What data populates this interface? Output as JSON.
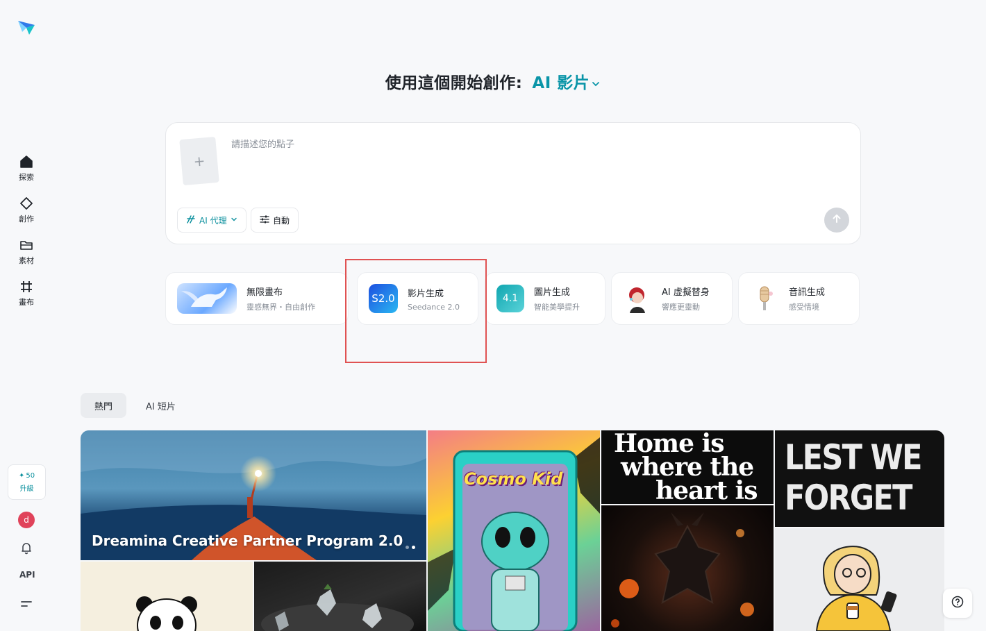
{
  "sidebar": {
    "items": [
      {
        "id": "explore",
        "label": "探索",
        "icon": "home-icon"
      },
      {
        "id": "create",
        "label": "創作",
        "icon": "diamond-icon"
      },
      {
        "id": "assets",
        "label": "素材",
        "icon": "folder-icon"
      },
      {
        "id": "canvas",
        "label": "畫布",
        "icon": "canvas-icon"
      }
    ],
    "credits": "50",
    "upgrade_label": "升級",
    "avatar_initial": "d",
    "api_label": "API"
  },
  "heading": {
    "prefix": "使用這個開始創作:",
    "mode": "AI 影片"
  },
  "prompt": {
    "placeholder": "請描述您的點子",
    "upload_icon": "+",
    "agent_label": "AI 代理",
    "auto_label": "自動"
  },
  "tools": [
    {
      "title": "無限畫布",
      "subtitle": "靈感無界・自由創作"
    },
    {
      "title": "影片生成",
      "subtitle": "Seedance 2.0",
      "badge": "S2.0"
    },
    {
      "title": "圖片生成",
      "subtitle": "智能美學提升",
      "badge": "4.1"
    },
    {
      "title": "AI 虛擬替身",
      "subtitle": "響應更靈動"
    },
    {
      "title": "音訊生成",
      "subtitle": "感受情境"
    }
  ],
  "tabs": {
    "hot": "熱門",
    "shorts": "AI 短片"
  },
  "gallery": {
    "hero_title": "Dreamina Creative Partner Program 2.0",
    "cosmo_text": "Cosmo Kid",
    "home_line1": "Home is",
    "home_line2": "where the",
    "home_line3": "heart is",
    "lest_line1": "LEST WE",
    "lest_line2": "FORGET"
  },
  "colors": {
    "accent": "#0a95a8",
    "highlight": "#e05252"
  }
}
